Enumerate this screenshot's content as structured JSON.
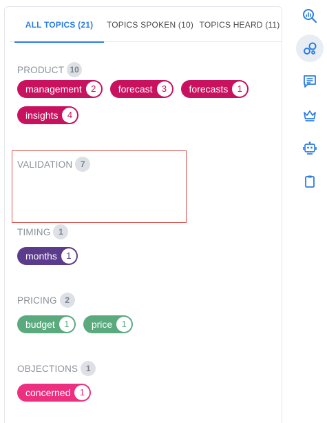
{
  "tabs": [
    {
      "label": "ALL TOPICS (21)"
    },
    {
      "label": "TOPICS SPOKEN (10)"
    },
    {
      "label": "TOPICS HEARD (11)"
    }
  ],
  "sections": {
    "product": {
      "title": "PRODUCT",
      "count": "10",
      "chips": [
        {
          "label": "management",
          "count": "2"
        },
        {
          "label": "forecast",
          "count": "3"
        },
        {
          "label": "forecasts",
          "count": "1"
        },
        {
          "label": "insights",
          "count": "4"
        }
      ]
    },
    "validation": {
      "title": "VALIDATION",
      "count": "7"
    },
    "timing": {
      "title": "TIMING",
      "count": "1",
      "chips": [
        {
          "label": "months",
          "count": "1"
        }
      ]
    },
    "pricing": {
      "title": "PRICING",
      "count": "2",
      "chips": [
        {
          "label": "budget",
          "count": "1"
        },
        {
          "label": "price",
          "count": "1"
        }
      ]
    },
    "objections": {
      "title": "OBJECTIONS",
      "count": "1",
      "chips": [
        {
          "label": "concerned",
          "count": "1"
        }
      ]
    }
  },
  "colors": {
    "accent": "#2a7de1",
    "product": "#c8125f",
    "timing": "#5b3b8c",
    "pricing": "#5aaa7e",
    "objections": "#ec2f7f",
    "highlight_border": "#d9534f"
  },
  "rail_icons": [
    "search-analytics-icon",
    "topics-icon",
    "comments-icon",
    "crown-icon",
    "robot-icon",
    "clipboard-icon"
  ]
}
